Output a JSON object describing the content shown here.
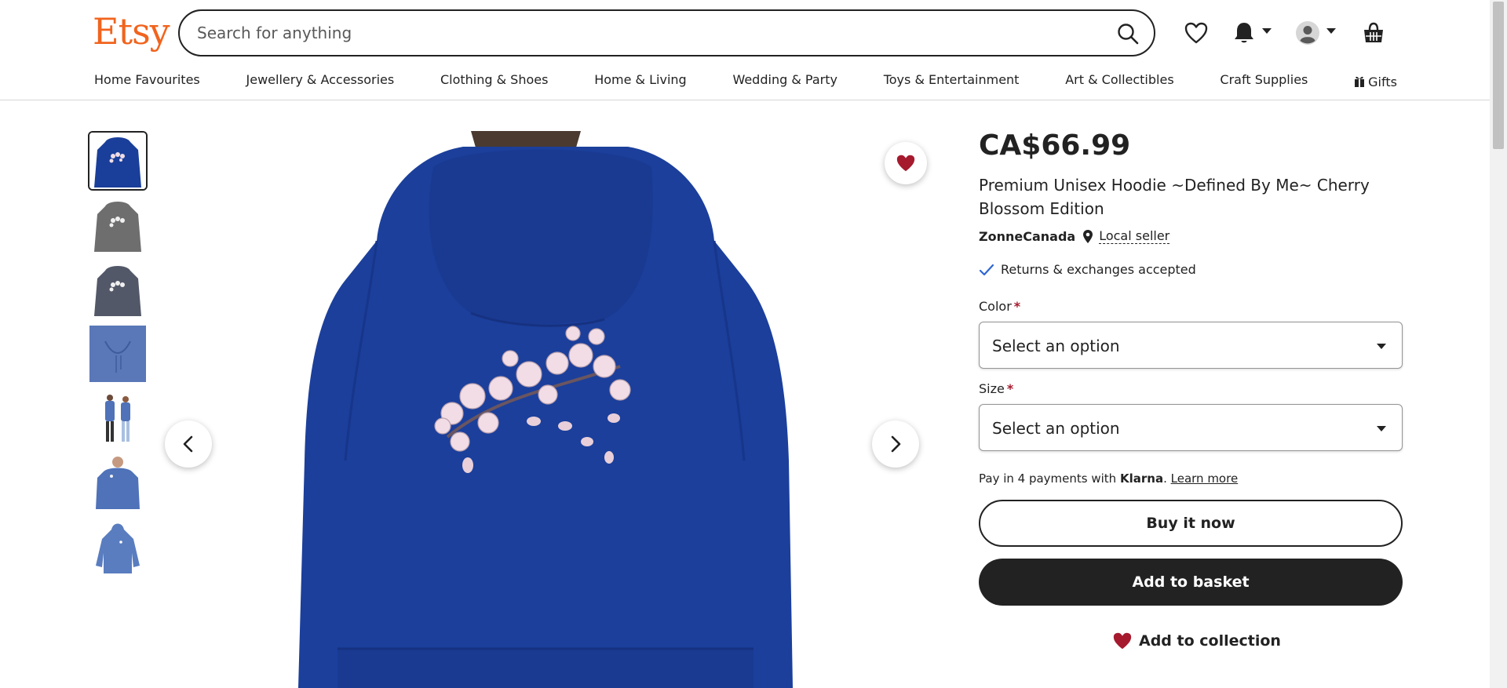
{
  "header": {
    "logo": "Etsy",
    "search_placeholder": "Search for anything",
    "icons": [
      "search-icon",
      "heart-icon",
      "bell-icon",
      "user-icon",
      "basket-icon"
    ]
  },
  "nav": [
    "Home Favourites",
    "Jewellery & Accessories",
    "Clothing & Shoes",
    "Home & Living",
    "Wedding & Party",
    "Toys & Entertainment",
    "Art & Collectibles",
    "Craft Supplies",
    "Gifts"
  ],
  "gallery": {
    "thumbnails_count": 7,
    "selected_index": 0
  },
  "product": {
    "price": "CA$66.99",
    "title": "Premium Unisex Hoodie ~Defined By Me~ Cherry Blossom Edition",
    "seller": "ZonneCanada",
    "local_label": "Local seller",
    "returns": "Returns & exchanges accepted",
    "color_label": "Color",
    "color_value": "Select an option",
    "size_label": "Size",
    "size_value": "Select an option",
    "klarna_prefix": "Pay in 4 payments with",
    "klarna_brand": "Klarna",
    "klarna_learn": "Learn more",
    "buy_now": "Buy it now",
    "add_basket": "Add to basket",
    "add_collection": "Add to collection",
    "required_mark": "*"
  },
  "colors": {
    "brand": "#f1641e",
    "hoodie_blue": "#1a3f9a",
    "heart_red": "#a61a2e"
  }
}
